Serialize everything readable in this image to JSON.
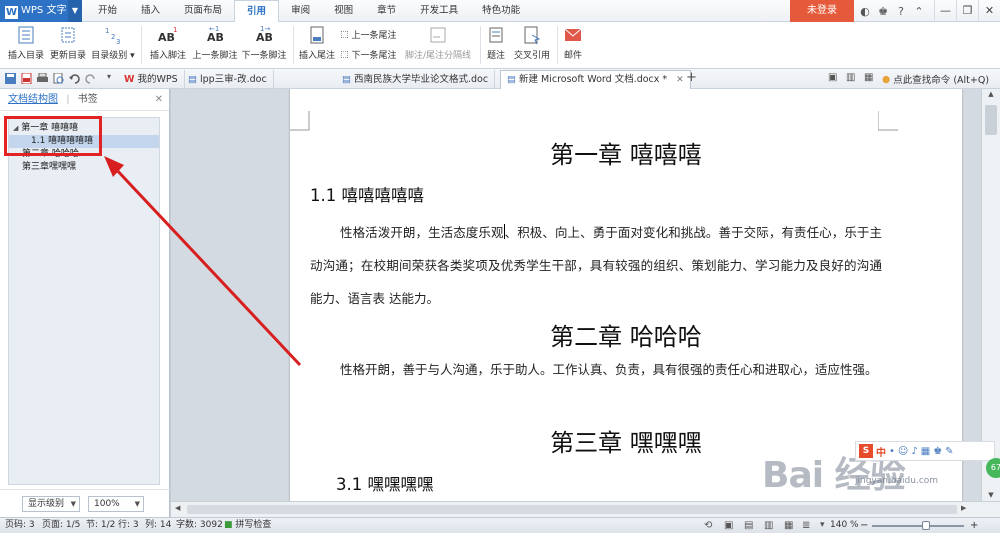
{
  "titlebar": {
    "app_name": "WPS 文字",
    "tabs": [
      "开始",
      "插入",
      "页面布局",
      "引用",
      "审阅",
      "视图",
      "章节",
      "开发工具",
      "特色功能"
    ],
    "active_tab": "引用",
    "login_label": "未登录"
  },
  "ribbon": {
    "insert_toc": "插入目录",
    "update_toc": "更新目录",
    "toc_level": "目录级别",
    "insert_footnote": "插入脚注",
    "prev_footnote": "上一条脚注",
    "next_footnote": "下一条脚注",
    "insert_endnote": "插入尾注",
    "prev_endnote": "上一条尾注",
    "next_endnote": "下一条尾注",
    "separator_line": "脚注/尾注分隔线",
    "caption": "题注",
    "cross_ref": "交叉引用",
    "mail": "邮件"
  },
  "quickbar": {
    "doc_tabs": [
      "我的WPS",
      "lpp三审-改.doc",
      "西南民族大学毕业论文格式.doc",
      "新建 Microsoft Word 文档.docx *"
    ],
    "search_hint": "点此查找命令 (Alt+Q)"
  },
  "navpane": {
    "tab_outline": "文档结构图",
    "tab_bookmark": "书签",
    "items": [
      {
        "label": "第一章  嘻嘻嘻",
        "level": 1
      },
      {
        "label": "1.1  嘻嘻嘻嘻嘻",
        "level": 2
      },
      {
        "label": "第二章  哈哈哈",
        "level": 1
      },
      {
        "label": "第三章嘿嘿嘿",
        "level": 1
      }
    ],
    "level_dropdown": "显示级别",
    "zoom_dropdown": "100%"
  },
  "document": {
    "chapter1": "第一章    嘻嘻嘻",
    "section11": "1.1  嘻嘻嘻嘻嘻",
    "para1_before_caret": "性格活泼开朗，生活态度乐观",
    "para1_after_caret": "、积极、向上、勇于面对变化和挑战。善于交际，有责任心，乐于主动沟通；在校期间荣获各类奖项及优秀学生干部，具有较强的组织、策划能力、学习能力及良好的沟通能力、语言表  达能力。",
    "chapter2": "第二章  哈哈哈",
    "para2": "性格开朗，善于与人沟通，乐于助人。工作认真、负责，具有很强的责任心和进取心，适应性强。",
    "chapter3": "第三章  嘿嘿嘿",
    "section31": "3.1  嘿嘿嘿嘿"
  },
  "statusbar": {
    "page_num": "页码: 3",
    "pages": "页面: 1/5",
    "section": "节: 1/2",
    "row": "行: 3",
    "col": "列: 14",
    "word_count": "字数: 3092",
    "spell_check": "拼写检查",
    "zoom": "140 %"
  },
  "watermark": {
    "text": "Bai 经验",
    "subtext": "jingyan.baidu.com",
    "badge_text": "中"
  },
  "colors": {
    "accent": "#2e72c5",
    "login": "#e55a3a",
    "highlight": "#e12323"
  }
}
